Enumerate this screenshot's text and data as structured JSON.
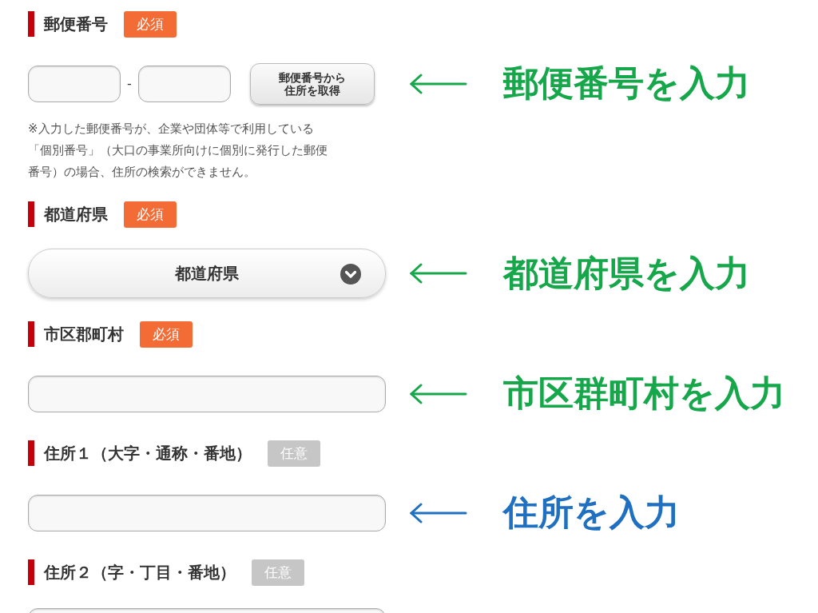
{
  "sections": [
    {
      "kind": "zip",
      "label": "郵便番号",
      "badge": {
        "text": "必須",
        "required": true
      },
      "separator": "-",
      "button": [
        "郵便番号から",
        "住所を取得"
      ],
      "note": "※入力した郵便番号が、企業や団体等で利用している「個別番号」（大口の事業所向けに個別に発行した郵便番号）の場合、住所の検索ができません。",
      "annotation": {
        "text": "郵便番号を入力",
        "color": "#17a74b"
      }
    },
    {
      "kind": "select",
      "label": "都道府県",
      "badge": {
        "text": "必須",
        "required": true
      },
      "value": "都道府県",
      "annotation": {
        "text": "都道府県を入力",
        "color": "#17a74b"
      }
    },
    {
      "kind": "text",
      "label": "市区郡町村",
      "badge": {
        "text": "必須",
        "required": true
      },
      "annotation": {
        "text": "市区群町村を入力",
        "color": "#17a74b"
      }
    },
    {
      "kind": "text",
      "label": "住所１（大字・通称・番地）",
      "badge": {
        "text": "任意",
        "required": false
      },
      "annotation": {
        "text": "住所を入力",
        "color": "#1f70c1"
      }
    },
    {
      "kind": "text",
      "label": "住所２（字・丁目・番地）",
      "badge": {
        "text": "任意",
        "required": false
      }
    }
  ]
}
